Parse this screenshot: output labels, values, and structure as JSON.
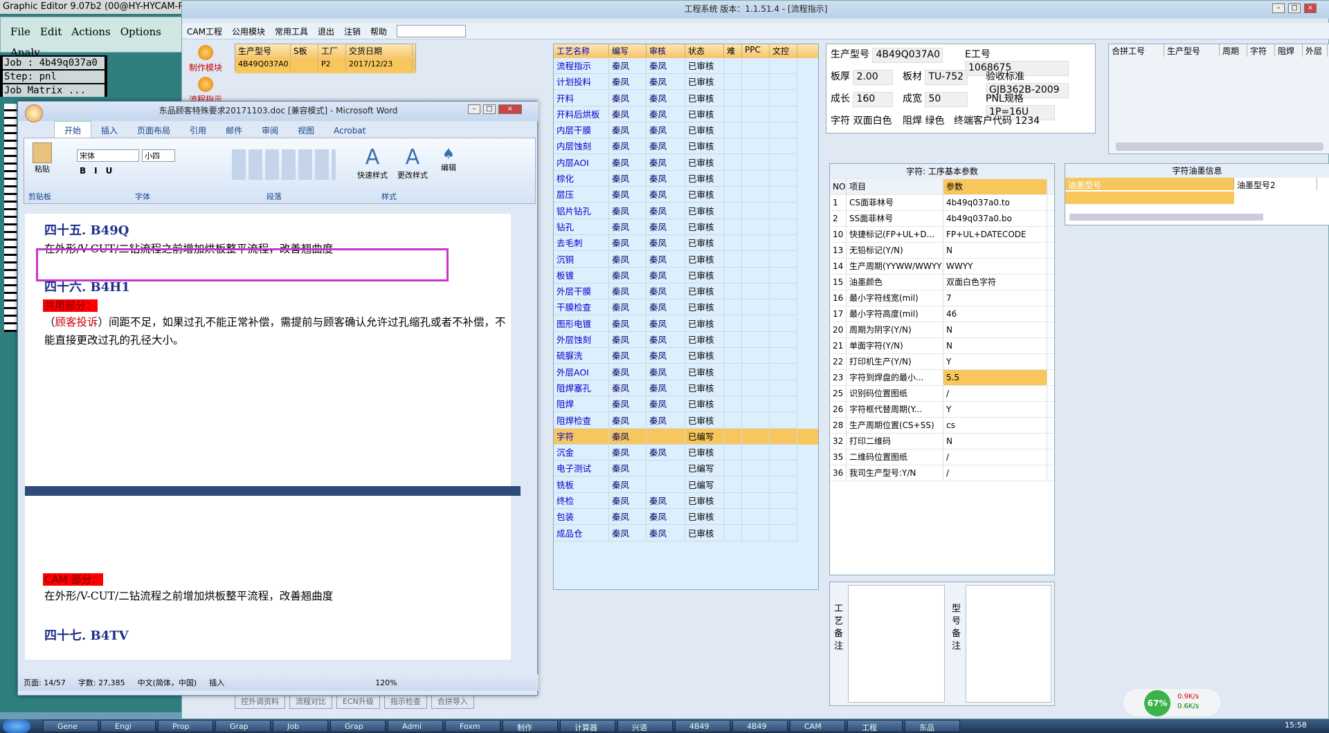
{
  "graphic_editor": {
    "title": "Graphic Editor 9.07b2 (00@HY-HYCAM-P",
    "menu": [
      "File",
      "Edit",
      "Actions",
      "Options",
      "Analy"
    ],
    "job": "Job : 4b49q037a0",
    "step": "Step: pnl",
    "matrix": "Job Matrix ..."
  },
  "app": {
    "title": "工程系统  版本：1.1.51.4 - [流程指示]",
    "menu": [
      "CAM工程",
      "公用模块",
      "常用工具",
      "退出",
      "注销",
      "帮助"
    ],
    "modules": [
      "制作模块",
      "流程指示"
    ],
    "product_headers": [
      "生产型号",
      "S板",
      "工厂",
      "交货日期"
    ],
    "product_row": [
      "4B49Q037A0",
      "",
      "P2",
      "2017/12/23"
    ],
    "flow_headers": [
      "工艺名称",
      "编写",
      "审核",
      "状态",
      "难",
      "PPC",
      "文控"
    ],
    "flow_rows": [
      [
        "流程指示",
        "秦凤",
        "秦凤",
        "已审核"
      ],
      [
        "计划投料",
        "秦凤",
        "秦凤",
        "已审核"
      ],
      [
        "开料",
        "秦凤",
        "秦凤",
        "已审核"
      ],
      [
        "开料后烘板",
        "秦凤",
        "秦凤",
        "已审核"
      ],
      [
        "内层干膜",
        "秦凤",
        "秦凤",
        "已审核"
      ],
      [
        "内层蚀刻",
        "秦凤",
        "秦凤",
        "已审核"
      ],
      [
        "内层AOI",
        "秦凤",
        "秦凤",
        "已审核"
      ],
      [
        "棕化",
        "秦凤",
        "秦凤",
        "已审核"
      ],
      [
        "层压",
        "秦凤",
        "秦凤",
        "已审核"
      ],
      [
        "铝片钻孔",
        "秦凤",
        "秦凤",
        "已审核"
      ],
      [
        "钻孔",
        "秦凤",
        "秦凤",
        "已审核"
      ],
      [
        "去毛刺",
        "秦凤",
        "秦凤",
        "已审核"
      ],
      [
        "沉铜",
        "秦凤",
        "秦凤",
        "已审核"
      ],
      [
        "板镀",
        "秦凤",
        "秦凤",
        "已审核"
      ],
      [
        "外层干膜",
        "秦凤",
        "秦凤",
        "已审核"
      ],
      [
        "干膜检查",
        "秦凤",
        "秦凤",
        "已审核"
      ],
      [
        "图形电镀",
        "秦凤",
        "秦凤",
        "已审核"
      ],
      [
        "外层蚀刻",
        "秦凤",
        "秦凤",
        "已审核"
      ],
      [
        "硫脲洗",
        "秦凤",
        "秦凤",
        "已审核"
      ],
      [
        "外层AOI",
        "秦凤",
        "秦凤",
        "已审核"
      ],
      [
        "阻焊塞孔",
        "秦凤",
        "秦凤",
        "已审核"
      ],
      [
        "阻焊",
        "秦凤",
        "秦凤",
        "已审核"
      ],
      [
        "阻焊检查",
        "秦凤",
        "秦凤",
        "已审核"
      ],
      [
        "字符",
        "秦凤",
        "",
        "已编写"
      ],
      [
        "沉金",
        "秦凤",
        "秦凤",
        "已审核"
      ],
      [
        "电子测试",
        "秦凤",
        "",
        "已编写"
      ],
      [
        "铣板",
        "秦凤",
        "",
        "已编写"
      ],
      [
        "终检",
        "秦凤",
        "秦凤",
        "已审核"
      ],
      [
        "包装",
        "秦凤",
        "秦凤",
        "已审核"
      ],
      [
        "成品仓",
        "秦凤",
        "秦凤",
        "已审核"
      ]
    ],
    "info": {
      "model_label": "生产型号",
      "model": "4B49Q037A0",
      "e_label": "E工号",
      "e": "1068675",
      "thick_label": "板厚",
      "thick": "2.00",
      "mat_label": "板材",
      "mat": "TU-752",
      "std_label": "验收标准",
      "std": "GJB362B-2009",
      "len_label": "成长",
      "len": "160",
      "wid_label": "成宽",
      "wid": "50",
      "pnl_label": "PNL规格",
      "pnl": "1P=16U",
      "char_label": "字符",
      "char": "双面白色",
      "mask_label": "阻焊",
      "mask": "绿色",
      "cust_label": "终端客户代码",
      "cust": "1234"
    },
    "merge_headers": [
      "合拼工号",
      "生产型号",
      "周期",
      "字符",
      "阻焊",
      "外层"
    ],
    "param_title": "字符: 工序基本参数",
    "param_headers": [
      "NO",
      "项目",
      "参数"
    ],
    "param_rows": [
      [
        "1",
        "CS面菲林号",
        "4b49q037a0.to"
      ],
      [
        "2",
        "SS面菲林号",
        "4b49q037a0.bo"
      ],
      [
        "10",
        "快捷标记(FP+UL+D...",
        "FP+UL+DATECODE"
      ],
      [
        "13",
        "无铅标记(Y/N)",
        "N"
      ],
      [
        "14",
        "生产周期(YYWW/WWYY)",
        "WWYY"
      ],
      [
        "15",
        "油墨颜色",
        "双面白色字符"
      ],
      [
        "16",
        "最小字符线宽(mil)",
        "7"
      ],
      [
        "17",
        "最小字符高度(mil)",
        "46"
      ],
      [
        "20",
        "周期为阴字(Y/N)",
        "N"
      ],
      [
        "21",
        "单面字符(Y/N)",
        "N"
      ],
      [
        "22",
        "打印机生产(Y/N)",
        "Y"
      ],
      [
        "23",
        "字符到焊盘的最小...",
        "5.5"
      ],
      [
        "25",
        "识别码位置图纸",
        "/"
      ],
      [
        "26",
        "字符框代替周期(Y...",
        "Y"
      ],
      [
        "28",
        "生产周期位置(CS+SS)",
        "cs"
      ],
      [
        "32",
        "打印二维码",
        "N"
      ],
      [
        "35",
        "二维码位置图纸",
        "/"
      ],
      [
        "36",
        "我司生产型号:Y/N",
        "/"
      ]
    ],
    "ink_title": "字符油墨信息",
    "ink_headers": [
      "油墨型号",
      "油墨型号2"
    ],
    "notes": [
      "工艺备注",
      "型号备注"
    ],
    "bottom_buttons": [
      "控外调资料",
      "流程对比",
      "ECN升级",
      "指示检查",
      "合拼导入"
    ]
  },
  "word": {
    "title": "东品顾客特殊要求20171103.doc [兼容模式] - Microsoft Word",
    "tabs": [
      "开始",
      "插入",
      "页面布局",
      "引用",
      "邮件",
      "审阅",
      "视图",
      "Acrobat"
    ],
    "font": "宋体",
    "size": "小四",
    "groups": [
      "剪贴板",
      "字体",
      "段落",
      "样式"
    ],
    "ribbon_big": [
      "粘贴",
      "快速样式",
      "更改样式",
      "编辑"
    ],
    "h45": "四十五. B49Q",
    "line1": "在外形/V-CUT/二钻流程之前增加烘板整平流程，改善翘曲度",
    "h46": "四十六. B4H1",
    "shared": "共用部分：",
    "complaint_prefix": "（",
    "complaint": "顾客投诉",
    "complaint_text": "）间距不足，如果过孔不能正常补偿，需提前与顾客确认允许过孔缩孔或者不补偿，不能直接更改过孔的孔径大小。",
    "cam": "CAM 部分：",
    "line2": "在外形/V-CUT/二钻流程之前增加烘板整平流程，改善翘曲度",
    "h47": "四十七. B4TV",
    "status_page": "页面: 14/57",
    "status_words": "字数: 27,385",
    "status_lang": "中文(简体，中国)",
    "status_mode": "插入",
    "zoom": "120%"
  },
  "net": {
    "percent": "67%",
    "up": "0.9K/s",
    "down": "0.6K/s"
  },
  "taskbar": [
    "Gene",
    "Engi",
    "Prop",
    "Grap",
    "Job",
    "Grap",
    "Admi",
    "Foxm",
    "制作",
    "计算器",
    "兴语",
    "4B49",
    "4B49",
    "CAM",
    "工程",
    "东品"
  ],
  "clock": "15:58"
}
